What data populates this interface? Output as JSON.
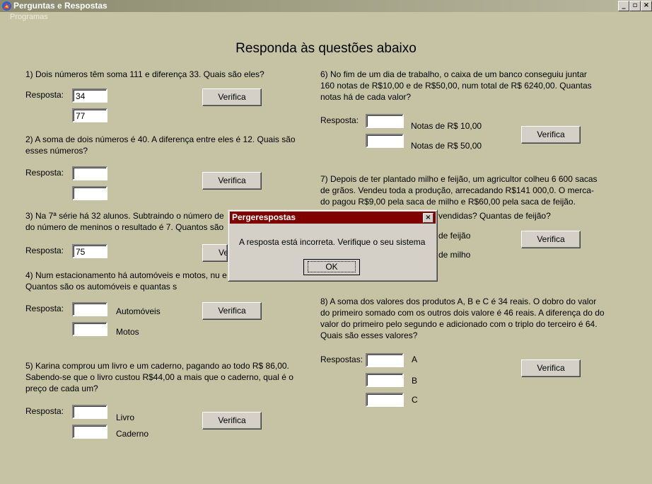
{
  "window": {
    "title": "Perguntas e Respostas",
    "minimize": "_",
    "maximize": "▫",
    "close": "×"
  },
  "menu": {
    "item": "Programas"
  },
  "heading": "Responda às questões abaixo",
  "q1": {
    "text": "1) Dois números têm soma 111 e diferença 33. Quais são eles?",
    "label": "Resposta:",
    "input1": "34",
    "input2": "77",
    "button": "Verifica"
  },
  "q2": {
    "text": "2) A soma de dois números é 40. A diferença entre eles é 12. Quais são esses números?",
    "label": "Resposta:",
    "input1": "",
    "input2": "",
    "button": "Verifica"
  },
  "q3": {
    "text": "3) Na 7ª série há 32 alunos. Subtraindo o número de do número de meninos o resultado é 7. Quantos são",
    "label": "Resposta:",
    "input1": "75",
    "button": "Ve"
  },
  "q4": {
    "text": "4) Num estacionamento há automóveis e motos, nu e 84 rodas. Quantos são os automóveis e quantas s",
    "label": "Resposta:",
    "input1": "",
    "input2": "",
    "label1": "Automóveis",
    "label2": "Motos",
    "button": "Verifica"
  },
  "q5": {
    "text": "5) Karina comprou um livro e um caderno, pagando ao todo R$ 86,00. Sabendo-se que o livro custou R$44,00 a mais que o caderno, qual é o preço de cada um?",
    "label": "Resposta:",
    "input1": "",
    "input2": "",
    "label1": "Livro",
    "label2": "Caderno",
    "button": "Verifica"
  },
  "q6": {
    "text": "6) No fim de um dia de trabalho, o caixa de um banco conseguiu juntar 160 notas de R$10,00 e de R$50,00, num total de R$ 6240,00. Quantas notas há de cada valor?",
    "label": "Resposta:",
    "input1": "",
    "input2": "",
    "label1": "Notas de R$ 10,00",
    "label2": "Notas de R$ 50,00",
    "button": "Verifica"
  },
  "q7": {
    "text": "7) Depois de ter plantado milho e feijão, um agricultor colheu 6 600 sacas de grãos. Vendeu toda a produção, arrecadando  R$141 000,0. O merca- do pagou R$9,00 pela saca de milho e R$60,00 pela saca de feijão.",
    "text_tail": "vendidas? Quantas de feijão?",
    "label1": "de feijão",
    "label2": "de milho",
    "button": "Verifica"
  },
  "q8": {
    "text": "8) A soma dos valores dos produtos A, B e C é 34 reais. O dobro do valor do primeiro somado com os outros dois valore é 46 reais. A diferença do do valor do primeiro pelo segundo  e adicionado com  o triplo do terceiro é 64. Quais são esses valores?",
    "label": "Respostas:",
    "input1": "",
    "input2": "",
    "input3": "",
    "label1": "A",
    "label2": "B",
    "label3": "C",
    "button": "Verifica"
  },
  "dialog": {
    "title": "Pergerespostas",
    "close": "×",
    "message": "A resposta está incorreta. Verifique o seu sistema",
    "ok": "OK"
  },
  "colors": {
    "client_bg": "#c6c3a5",
    "dialog_title_bg": "#800000"
  }
}
